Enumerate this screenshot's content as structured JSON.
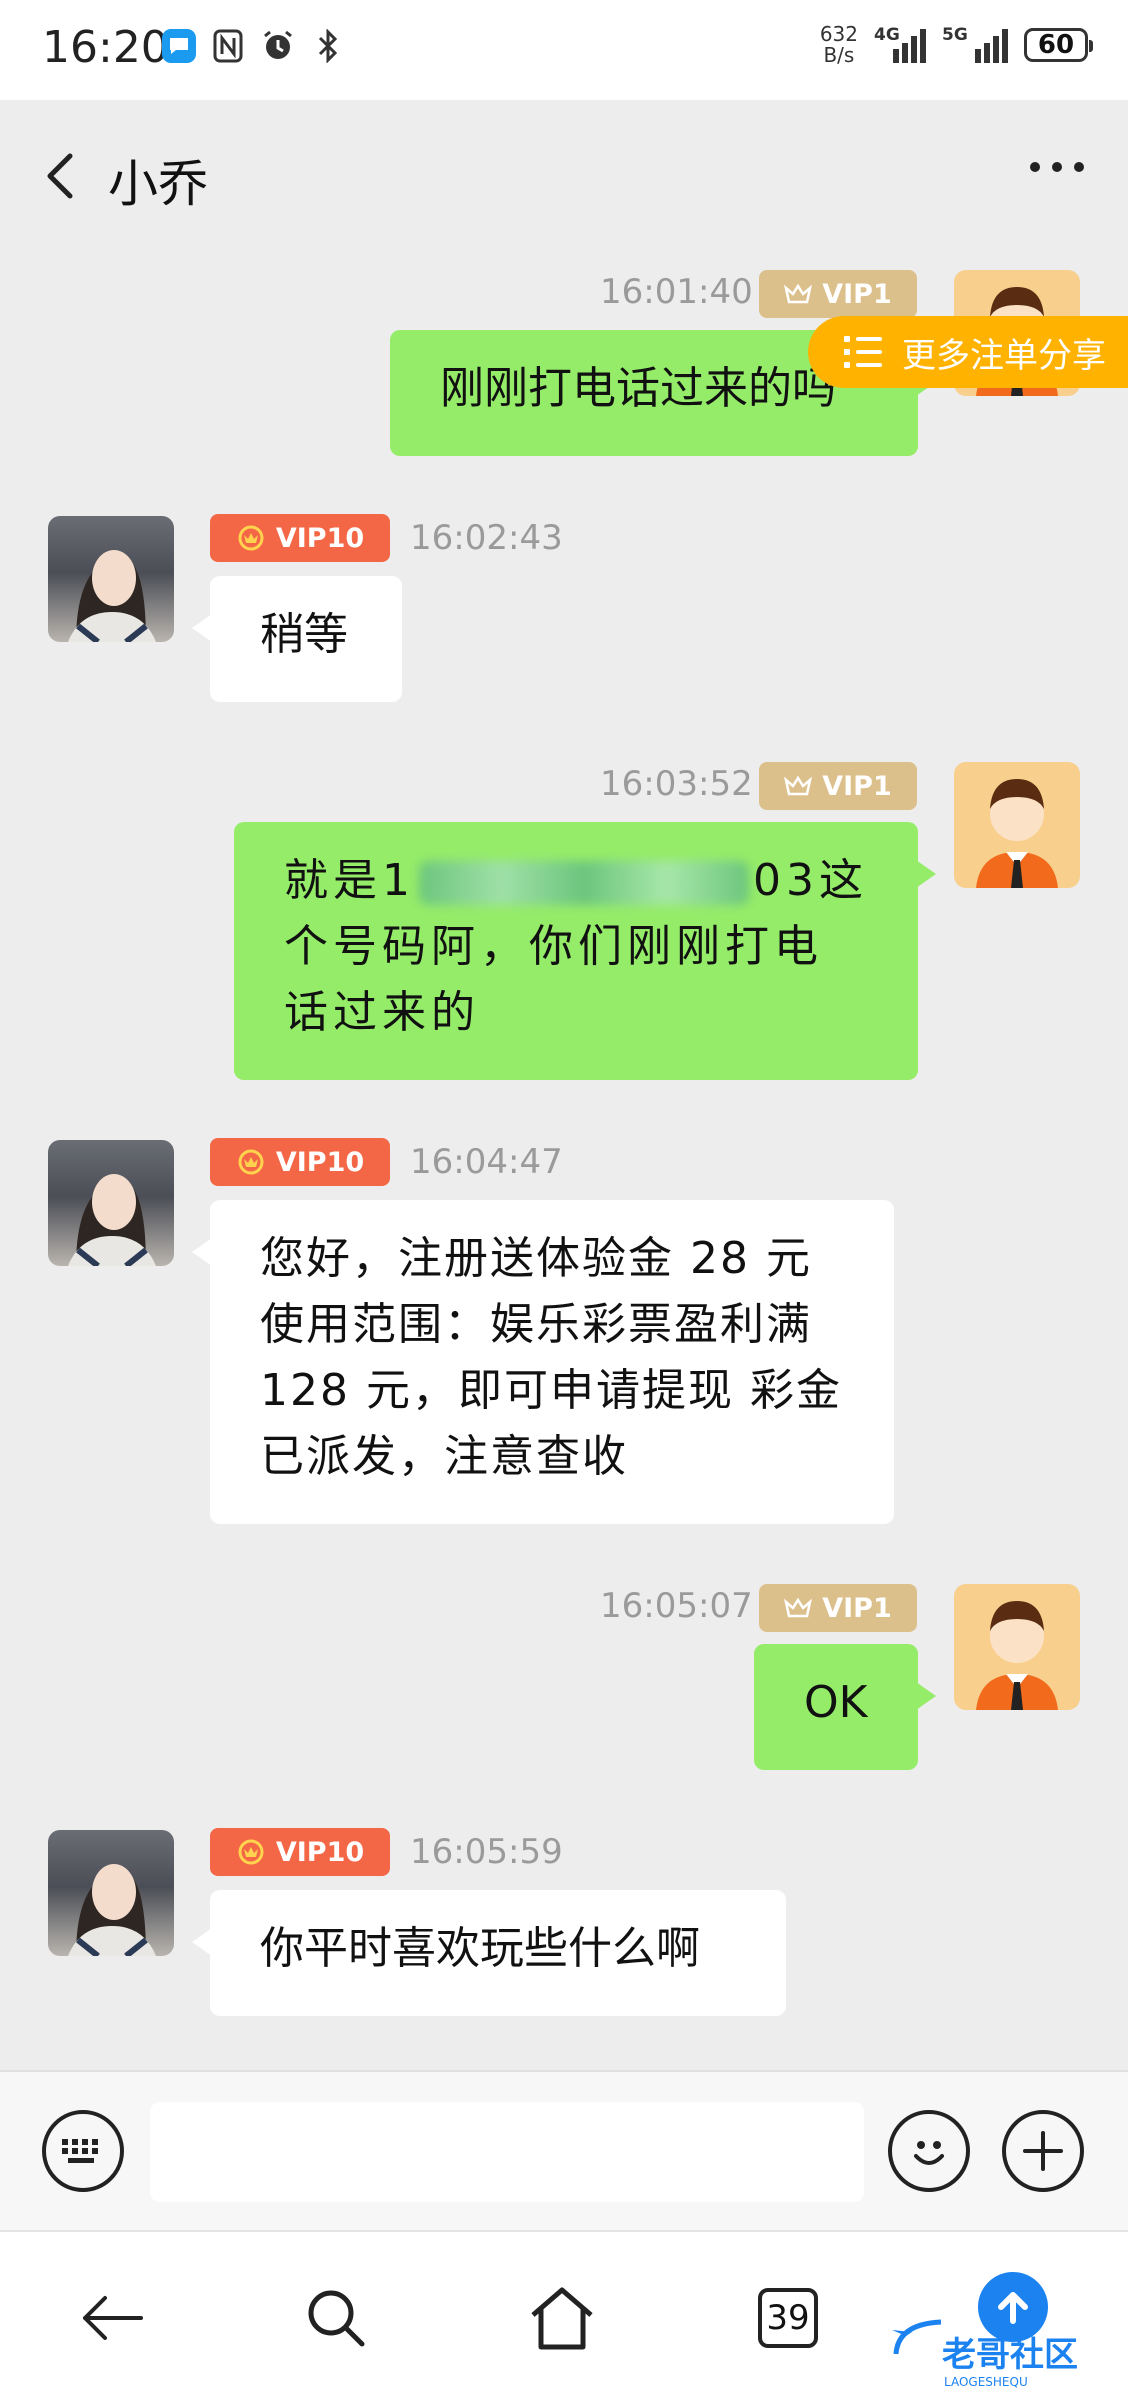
{
  "status_bar": {
    "time": "16:20",
    "net_speed_value": "632",
    "net_speed_unit": "B/s",
    "signal1_label": "4G",
    "signal2_label": "5G",
    "battery": "60"
  },
  "header": {
    "title": "小乔"
  },
  "share_pill": {
    "label": "更多注单分享"
  },
  "badges": {
    "me": "VIP1",
    "her": "VIP10"
  },
  "messages": [
    {
      "from": "me",
      "time": "16:01:40",
      "text": "刚刚打电话过来的吗"
    },
    {
      "from": "her",
      "time": "16:02:43",
      "text": "稍等"
    },
    {
      "from": "me",
      "time": "16:03:52",
      "text_before": "就是",
      "text_prefix": "1",
      "text_suffix": "03",
      "text_after": "这个号码阿，你们刚刚打电话过来的"
    },
    {
      "from": "her",
      "time": "16:04:47",
      "text": "您好，注册送体验金 28 元使用范围：娱乐彩票盈利满128 元，即可申请提现 彩金已派发，注意查收"
    },
    {
      "from": "me",
      "time": "16:05:07",
      "text": "OK"
    },
    {
      "from": "her",
      "time": "16:05:59",
      "text": "你平时喜欢玩些什么啊"
    }
  ],
  "input": {
    "placeholder": "",
    "value": ""
  },
  "nav": {
    "tab_count": "39"
  },
  "watermark": {
    "text": "老哥社区",
    "sub": "LAOGESHEQU"
  },
  "colors": {
    "green_bubble": "#95ec69",
    "vip1": "#dcc08c",
    "vip10": "#f36646",
    "share": "#ffb300"
  }
}
